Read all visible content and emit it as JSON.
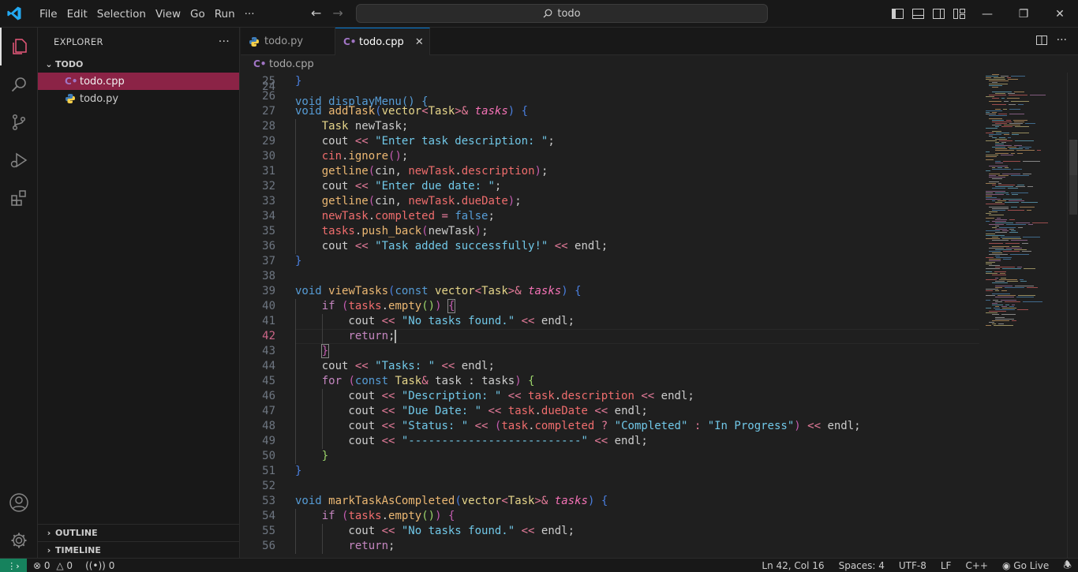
{
  "window": {
    "search_text": "todo",
    "menu": [
      "File",
      "Edit",
      "Selection",
      "View",
      "Go",
      "Run",
      "···"
    ],
    "accent": "#0078d4"
  },
  "sidebar": {
    "title": "EXPLORER",
    "more": "···",
    "folder": "TODO",
    "files": [
      {
        "name": "todo.cpp",
        "icon": "cpp-file-icon",
        "selected": true
      },
      {
        "name": "todo.py",
        "icon": "python-file-icon",
        "selected": false
      }
    ],
    "outline": "OUTLINE",
    "timeline": "TIMELINE"
  },
  "editor": {
    "tabs": [
      {
        "label": "todo.py",
        "active": false
      },
      {
        "label": "todo.cpp",
        "active": true
      }
    ],
    "breadcrumb": "todo.cpp",
    "current_line": 42,
    "first_visible_line": 24,
    "partial_line_text": "void displayMenu() {"
  },
  "code_lines": [
    {
      "n": 25,
      "html": "<span class='b1'>}</span>"
    },
    {
      "n": 26,
      "html": ""
    },
    {
      "n": 27,
      "html": "<span class='kb'>void</span> <span class='f'>addTask</span><span class='b1'>(</span><span class='t'>vector</span><span class='o'>&lt;</span><span class='t'>Task</span><span class='o'>&gt;&amp;</span> <span class='p'>tasks</span><span class='b1'>)</span> <span class='b1'>{</span>"
    },
    {
      "n": 28,
      "html": "    <span class='t'>Task</span> newTask;"
    },
    {
      "n": 29,
      "html": "    cout <span class='o'>&lt;&lt;</span> <span class='s'>\"Enter task description: \"</span>;"
    },
    {
      "n": 30,
      "html": "    <span class='r'>cin</span>.<span class='f'>ignore</span><span class='b2'>()</span>;"
    },
    {
      "n": 31,
      "html": "    <span class='f'>getline</span><span class='b2'>(</span>cin, <span class='r'>newTask</span>.<span class='r'>description</span><span class='b2'>)</span>;"
    },
    {
      "n": 32,
      "html": "    cout <span class='o'>&lt;&lt;</span> <span class='s'>\"Enter due date: \"</span>;"
    },
    {
      "n": 33,
      "html": "    <span class='f'>getline</span><span class='b2'>(</span>cin, <span class='r'>newTask</span>.<span class='r'>dueDate</span><span class='b2'>)</span>;"
    },
    {
      "n": 34,
      "html": "    <span class='r'>newTask</span>.<span class='r'>completed</span> <span class='o'>=</span> <span class='kb'>false</span>;"
    },
    {
      "n": 35,
      "html": "    <span class='r'>tasks</span>.<span class='f'>push_back</span><span class='b2'>(</span>newTask<span class='b2'>)</span>;"
    },
    {
      "n": 36,
      "html": "    cout <span class='o'>&lt;&lt;</span> <span class='s'>\"Task added successfully!\"</span> <span class='o'>&lt;&lt;</span> endl;"
    },
    {
      "n": 37,
      "html": "<span class='b1'>}</span>"
    },
    {
      "n": 38,
      "html": ""
    },
    {
      "n": 39,
      "html": "<span class='kb'>void</span> <span class='f'>viewTasks</span><span class='b1'>(</span><span class='kb'>const</span> <span class='t'>vector</span><span class='o'>&lt;</span><span class='t'>Task</span><span class='o'>&gt;&amp;</span> <span class='p'>tasks</span><span class='b1'>)</span> <span class='b1'>{</span>"
    },
    {
      "n": 40,
      "html": "    <span class='k'>if</span> <span class='b2'>(</span><span class='r'>tasks</span>.<span class='f'>empty</span><span class='b3'>()</span><span class='b2'>)</span> <span class='b2 box'>{</span>"
    },
    {
      "n": 41,
      "html": "        cout <span class='o'>&lt;&lt;</span> <span class='s'>\"No tasks found.\"</span> <span class='o'>&lt;&lt;</span> endl;"
    },
    {
      "n": 42,
      "html": "        <span class='k'>return</span>;<span class='cursor'></span>"
    },
    {
      "n": 43,
      "html": "    <span class='b2 box'>}</span>"
    },
    {
      "n": 44,
      "html": "    cout <span class='o'>&lt;&lt;</span> <span class='s'>\"Tasks: \"</span> <span class='o'>&lt;&lt;</span> endl;"
    },
    {
      "n": 45,
      "html": "    <span class='k'>for</span> <span class='b2'>(</span><span class='kb'>const</span> <span class='t'>Task</span><span class='o'>&amp;</span> task : tasks<span class='b2'>)</span> <span class='b3'>{</span>"
    },
    {
      "n": 46,
      "html": "        cout <span class='o'>&lt;&lt;</span> <span class='s'>\"Description: \"</span> <span class='o'>&lt;&lt;</span> <span class='r'>task</span>.<span class='r'>description</span> <span class='o'>&lt;&lt;</span> endl;"
    },
    {
      "n": 47,
      "html": "        cout <span class='o'>&lt;&lt;</span> <span class='s'>\"Due Date: \"</span> <span class='o'>&lt;&lt;</span> <span class='r'>task</span>.<span class='r'>dueDate</span> <span class='o'>&lt;&lt;</span> endl;"
    },
    {
      "n": 48,
      "html": "        cout <span class='o'>&lt;&lt;</span> <span class='s'>\"Status: \"</span> <span class='o'>&lt;&lt;</span> <span class='b2'>(</span><span class='r'>task</span>.<span class='r'>completed</span> <span class='o'>?</span> <span class='s'>\"Completed\"</span> <span class='o'>:</span> <span class='s'>\"In Progress\"</span><span class='b2'>)</span> <span class='o'>&lt;&lt;</span> endl;"
    },
    {
      "n": 49,
      "html": "        cout <span class='o'>&lt;&lt;</span> <span class='s'>\"--------------------------\"</span> <span class='o'>&lt;&lt;</span> endl;"
    },
    {
      "n": 50,
      "html": "    <span class='b3'>}</span>"
    },
    {
      "n": 51,
      "html": "<span class='b1'>}</span>"
    },
    {
      "n": 52,
      "html": ""
    },
    {
      "n": 53,
      "html": "<span class='kb'>void</span> <span class='f'>markTaskAsCompleted</span><span class='b1'>(</span><span class='t'>vector</span><span class='o'>&lt;</span><span class='t'>Task</span><span class='o'>&gt;&amp;</span> <span class='p'>tasks</span><span class='b1'>)</span> <span class='b1'>{</span>"
    },
    {
      "n": 54,
      "html": "    <span class='k'>if</span> <span class='b2'>(</span><span class='r'>tasks</span>.<span class='f'>empty</span><span class='b3'>()</span><span class='b2'>)</span> <span class='b2'>{</span>"
    },
    {
      "n": 55,
      "html": "        cout <span class='o'>&lt;&lt;</span> <span class='s'>\"No tasks found.\"</span> <span class='o'>&lt;&lt;</span> endl;"
    },
    {
      "n": 56,
      "html": "        <span class='k'>return</span>;"
    }
  ],
  "status": {
    "errors": "0",
    "warnings": "0",
    "ports": "0",
    "position": "Ln 42, Col 16",
    "spaces": "Spaces: 4",
    "encoding": "UTF-8",
    "eol": "LF",
    "language": "C++",
    "live": "Go Live"
  }
}
